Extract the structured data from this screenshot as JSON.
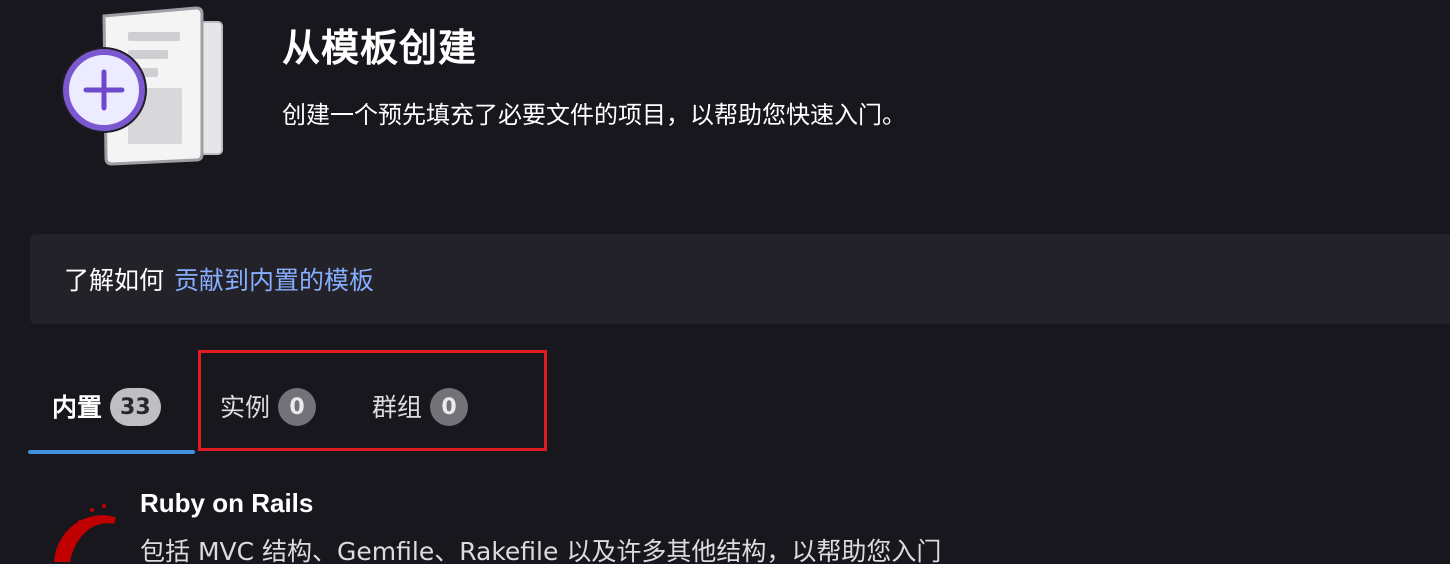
{
  "header": {
    "title": "从模板创建",
    "subtitle": "创建一个预先填充了必要文件的项目，以帮助您快速入门。",
    "illustration_icon": "template-plus-icon"
  },
  "banner": {
    "prefix": "了解如何",
    "link_label": "贡献到内置的模板"
  },
  "tabs": [
    {
      "label": "内置",
      "count": "33",
      "active": true
    },
    {
      "label": "实例",
      "count": "0",
      "active": false
    },
    {
      "label": "群组",
      "count": "0",
      "active": false
    }
  ],
  "templates": [
    {
      "name": "Ruby on Rails",
      "description": "包括 MVC 结构、Gemfile、Rakefile 以及许多其他结构，以帮助您入门",
      "icon": "ruby-on-rails-logo"
    }
  ],
  "colors": {
    "background": "#18171d",
    "banner_bg": "#232229",
    "link": "#87aeff",
    "tab_underline": "#428fdc",
    "highlight_border": "#e01b24",
    "purple_accent": "#7b58cf"
  }
}
